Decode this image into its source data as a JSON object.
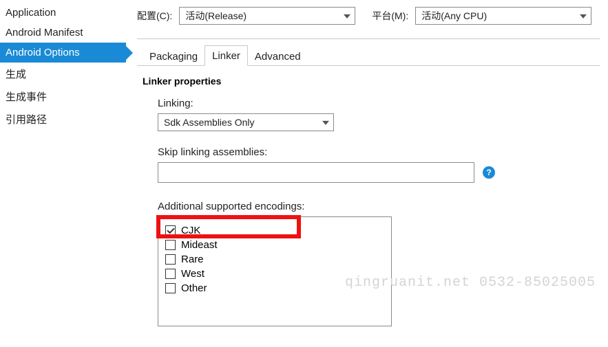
{
  "sidebar": {
    "items": [
      {
        "label": "Application"
      },
      {
        "label": "Android Manifest"
      },
      {
        "label": "Android Options"
      },
      {
        "label": "生成"
      },
      {
        "label": "生成事件"
      },
      {
        "label": "引用路径"
      }
    ],
    "selected_index": 2
  },
  "top": {
    "config_label": "配置(C):",
    "config_value": "活动(Release)",
    "platform_label": "平台(M):",
    "platform_value": "活动(Any CPU)"
  },
  "tabs": {
    "items": [
      {
        "label": "Packaging"
      },
      {
        "label": "Linker"
      },
      {
        "label": "Advanced"
      }
    ],
    "active_index": 1
  },
  "linker": {
    "section_title": "Linker properties",
    "linking_label": "Linking:",
    "linking_value": "Sdk Assemblies Only",
    "skip_label": "Skip linking assemblies:",
    "skip_value": "",
    "encodings_label": "Additional supported encodings:",
    "encodings": [
      {
        "label": "CJK",
        "checked": true
      },
      {
        "label": "Mideast",
        "checked": false
      },
      {
        "label": "Rare",
        "checked": false
      },
      {
        "label": "West",
        "checked": false
      },
      {
        "label": "Other",
        "checked": false
      }
    ],
    "highlight_index": 0
  },
  "watermark": "qingruanit.net 0532-85025005"
}
